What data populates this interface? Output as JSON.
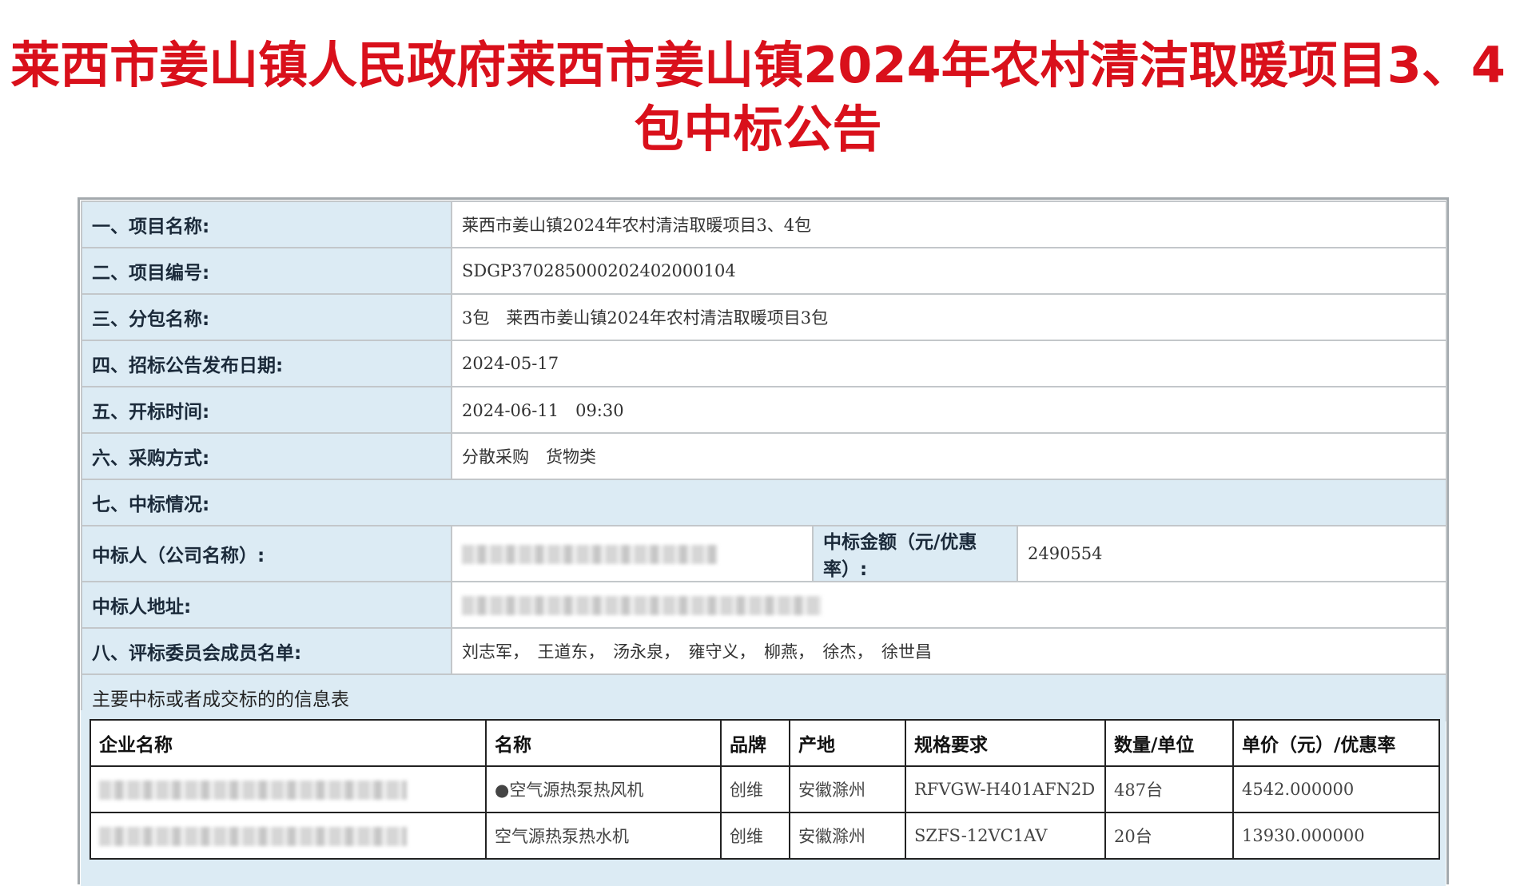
{
  "page_title": "莱西市姜山镇人民政府莱西市姜山镇2024年农村清洁取暖项目3、4包中标公告",
  "rows": [
    {
      "label": "一、项目名称:",
      "value": "莱西市姜山镇2024年农村清洁取暖项目3、4包"
    },
    {
      "label": "二、项目编号:",
      "value": "SDGP370285000202402000104"
    },
    {
      "label": "三、分包名称:",
      "value": "3包　莱西市姜山镇2024年农村清洁取暖项目3包"
    },
    {
      "label": "四、招标公告发布日期:",
      "value": "2024-05-17"
    },
    {
      "label": "五、开标时间:",
      "value": "2024-06-11　09:30"
    },
    {
      "label": "六、采购方式:",
      "value": "分散采购　货物类"
    }
  ],
  "section7_label": "七、中标情况:",
  "winner": {
    "name_label": "中标人（公司名称）:",
    "amount_label": "中标金额（元/优惠率）:",
    "amount_value": "2490554",
    "address_label": "中标人地址:"
  },
  "committee": {
    "label": "八、评标委员会成员名单:",
    "value": "刘志军，　王道东，　汤永泉，　雍守义，　柳燕，　徐杰，　徐世昌"
  },
  "award_table": {
    "caption": "主要中标或者成交标的的信息表",
    "headers": [
      "企业名称",
      "名称",
      "品牌",
      "产地",
      "规格要求",
      "数量/单位",
      "单价（元）/优惠率"
    ],
    "rows": [
      {
        "name": "●空气源热泵热风机",
        "brand": "创维",
        "origin": "安徽滁州",
        "spec": "RFVGW-H401AFN2D",
        "qty": "487台",
        "price": "4542.000000"
      },
      {
        "name": "空气源热泵热水机",
        "brand": "创维",
        "origin": "安徽滁州",
        "spec": "SZFS-12VC1AV",
        "qty": "20台",
        "price": "13930.000000"
      }
    ]
  }
}
